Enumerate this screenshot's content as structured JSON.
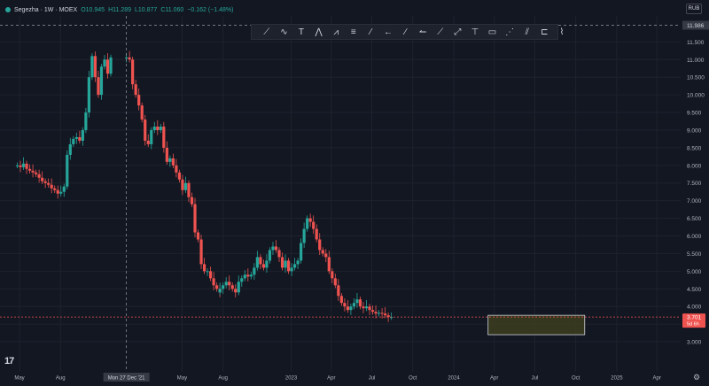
{
  "legend": {
    "title": "Segezha · 1W · MOEX",
    "open": "O10.945",
    "high": "H11.289",
    "low": "L10.877",
    "close": "C11.060",
    "change": "−0.162 (−1.48%)"
  },
  "currency": "RUB",
  "crosshair": {
    "price_label": "11.986",
    "date_label": "Mon 27 Dec '21"
  },
  "last_price": {
    "value": "3.701",
    "countdown": "5d 6h"
  },
  "toolbar_icons": [
    "trend-pattern-icon",
    "elliott-wave-icon",
    "text-icon",
    "triangle-pattern-icon",
    "abcd-pattern-icon",
    "fib-retracement-icon",
    "trend-line-icon",
    "arrow-left-icon",
    "ray-icon",
    "arrow-line-icon",
    "long-ray-icon",
    "extended-line-icon",
    "vertical-line-icon",
    "rectangle-icon",
    "brush-icon",
    "pitchfork-icon",
    "forecast-icon",
    "path-icon"
  ],
  "logo": "17",
  "colors": {
    "up": "#26a69a",
    "down": "#ef5350",
    "background": "#131722",
    "grid": "#1e222d",
    "zone_fill": "#3d3d1e",
    "zone_border": "#d1d4dc"
  },
  "chart_data": {
    "type": "candlestick",
    "timeframe": "1W",
    "exchange": "MOEX",
    "symbol": "Segezha",
    "y_ticks": [
      "11.500",
      "11.000",
      "10.500",
      "10.000",
      "9.500",
      "9.000",
      "8.500",
      "8.000",
      "7.500",
      "7.000",
      "6.500",
      "6.000",
      "5.500",
      "5.000",
      "4.500",
      "4.000",
      "3.500",
      "3.000"
    ],
    "ylim": [
      2.75,
      11.986
    ],
    "x_ticks": [
      "May",
      "Aug",
      "Mon 27 Dec '21",
      "May",
      "Aug",
      "2023",
      "Apr",
      "Jul",
      "Oct",
      "2024",
      "Apr",
      "Jul",
      "Oct",
      "2025",
      "Apr"
    ],
    "x_tick_dates": [
      "2021-05-01",
      "2021-08-01",
      "2021-12-27",
      "2022-05-01",
      "2022-08-01",
      "2023-01-01",
      "2023-04-01",
      "2023-07-01",
      "2023-10-01",
      "2024-01-01",
      "2024-04-01",
      "2024-07-01",
      "2024-10-01",
      "2025-01-01",
      "2025-04-01"
    ],
    "weekly_closes": [
      {
        "start": "2021-04-26",
        "closes": [
          8.0,
          7.95,
          8.05,
          7.9,
          7.85,
          7.8,
          7.75,
          7.65,
          7.55,
          7.5,
          7.45,
          7.35,
          7.3,
          7.2,
          7.25,
          7.4,
          8.3,
          8.6,
          8.75,
          8.8,
          8.7,
          9.0,
          9.5,
          10.5,
          11.1,
          10.5,
          10.0,
          10.8,
          11.0,
          10.6,
          11.06
        ]
      },
      {
        "start": "2021-12-27",
        "closes": [
          11.06,
          11.0,
          10.3,
          10.0,
          9.7,
          9.3,
          8.7,
          8.6,
          9.0,
          9.1,
          9.0,
          9.1,
          8.5,
          8.1,
          8.2,
          8.0,
          7.8,
          7.6,
          7.3,
          7.5,
          7.1,
          6.9,
          6.1,
          5.9,
          5.2,
          5.0,
          5.0,
          4.8,
          4.6,
          4.5,
          4.4
        ]
      },
      {
        "start": "2022-07-25",
        "closes": [
          4.5,
          4.6,
          4.7,
          4.6,
          4.5,
          4.4,
          4.7,
          4.8,
          4.9,
          4.85,
          4.9,
          5.1,
          5.4,
          5.2,
          5.1,
          5.3,
          5.6,
          5.7,
          5.6,
          5.4,
          5.1,
          5.3,
          5.0,
          5.1,
          5.2,
          5.3,
          5.8,
          6.2,
          6.5,
          6.4,
          6.3
        ]
      },
      {
        "start": "2023-02-20",
        "closes": [
          6.2,
          5.9,
          5.6,
          5.5,
          5.4,
          5.0,
          4.8,
          4.6,
          4.3,
          4.1,
          4.0,
          3.9,
          4.0,
          4.1,
          4.2,
          4.0,
          3.95,
          4.0,
          3.9,
          3.85,
          3.8,
          3.82,
          3.8,
          3.75,
          3.7,
          3.701
        ]
      }
    ],
    "price_range_points": [
      {
        "date": "2021-04-26",
        "price": 8.0
      },
      {
        "date": "2021-08-16",
        "price": 7.2
      },
      {
        "date": "2021-10-04",
        "price": 8.7
      },
      {
        "date": "2021-11-15",
        "price": 10.5
      },
      {
        "date": "2021-12-27",
        "price": 11.06
      },
      {
        "date": "2022-03-07",
        "price": 8.7
      },
      {
        "date": "2022-05-30",
        "price": 7.5
      },
      {
        "date": "2022-08-15",
        "price": 7.0
      },
      {
        "date": "2022-09-12",
        "price": 4.6
      },
      {
        "date": "2022-10-17",
        "price": 4.4
      },
      {
        "date": "2023-01-09",
        "price": 4.9
      },
      {
        "date": "2023-03-06",
        "price": 5.6
      },
      {
        "date": "2023-04-10",
        "price": 5.3
      },
      {
        "date": "2023-05-15",
        "price": 5.2
      },
      {
        "date": "2023-07-10",
        "price": 6.3
      },
      {
        "date": "2023-08-28",
        "price": 5.5
      },
      {
        "date": "2023-10-09",
        "price": 4.8
      },
      {
        "date": "2023-11-06",
        "price": 4.0
      },
      {
        "date": "2024-01-08",
        "price": 4.1
      },
      {
        "date": "2024-03-04",
        "price": 3.9
      },
      {
        "date": "2024-04-22",
        "price": 3.8
      },
      {
        "date": "2024-05-13",
        "price": 3.701
      }
    ],
    "zone": {
      "date_start": "2024-03-18",
      "date_end": "2024-10-21",
      "price_top": 3.75,
      "price_bottom": 3.2
    },
    "last_close": 3.701
  }
}
